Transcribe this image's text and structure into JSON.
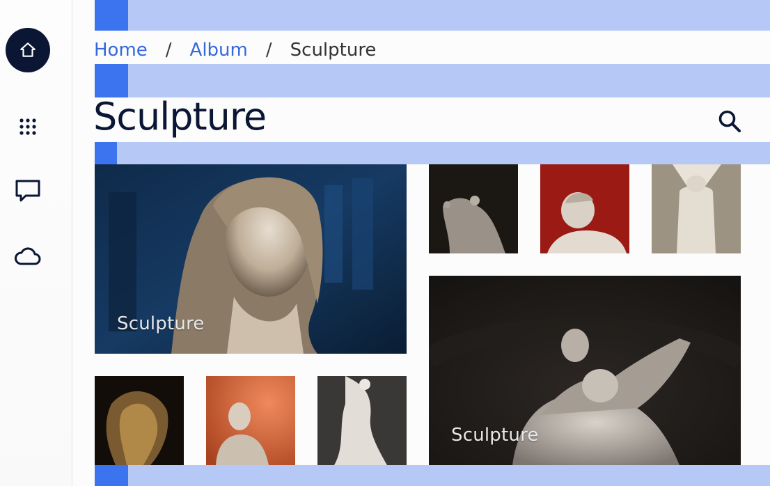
{
  "rail": {
    "items": [
      {
        "icon": "home-icon",
        "active": true
      },
      {
        "icon": "apps-grid-icon",
        "active": false
      },
      {
        "icon": "chat-icon",
        "active": false
      },
      {
        "icon": "cloud-icon",
        "active": false
      }
    ]
  },
  "breadcrumb": {
    "home": "Home",
    "album": "Album",
    "current": "Sculpture",
    "separator": "/"
  },
  "page": {
    "title": "Sculpture",
    "search_icon": "search-icon"
  },
  "gallery": {
    "featured_left_caption": "Sculpture",
    "featured_right_caption": "Sculpture",
    "thumbnails": [
      "sculpture-thumb-1",
      "sculpture-thumb-2",
      "sculpture-thumb-3",
      "sculpture-thumb-4",
      "sculpture-thumb-5",
      "sculpture-thumb-6"
    ]
  },
  "colors": {
    "accent": "#3c73ef",
    "band": "#b6c9f6",
    "active_rail": "#0b1635",
    "link": "#3468dc"
  }
}
